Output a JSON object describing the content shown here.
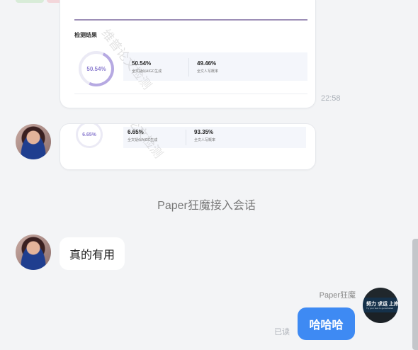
{
  "report_card": {
    "section_title": "检测结果",
    "percent": "50.54%",
    "stat1_value": "50.54%",
    "stat1_label": "全文疑似AIGC生成",
    "stat2_value": "49.46%",
    "stat2_label": "全文人写概率",
    "timestamp": "22:58",
    "watermark": "维普论文检测"
  },
  "report_card_2": {
    "percent": "6.65%",
    "stat1_value": "6.65%",
    "stat1_label": "全文疑似AIGC生成",
    "stat2_value": "93.35%",
    "stat2_label": "全文人写概率",
    "watermark": "维普论文检测"
  },
  "system_message": "Paper狂魔接入会话",
  "messages": {
    "customer_text": "真的有用",
    "agent_name": "Paper狂魔",
    "agent_text": "哈哈哈",
    "read_status": "已读"
  },
  "agent_avatar": {
    "sign_text": "努力 求运 上岸",
    "sign_sub": "Try your best to get admitted"
  },
  "colors": {
    "accent": "#3e8af3",
    "ring": "#b6a9e2",
    "background": "#f3f4f6"
  }
}
